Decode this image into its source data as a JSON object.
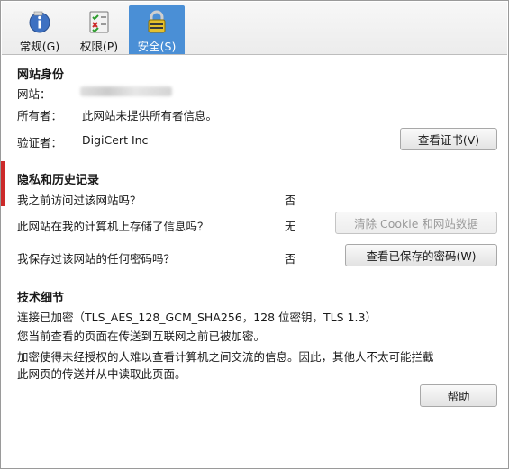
{
  "tabs": [
    {
      "label": "常规(G)",
      "icon": "info-icon"
    },
    {
      "label": "权限(P)",
      "icon": "permissions-icon"
    },
    {
      "label": "安全(S)",
      "icon": "lock-icon",
      "active": true
    }
  ],
  "identity": {
    "title": "网站身份",
    "website_label": "网站：",
    "owner_label": "所有者：",
    "owner_value": "此网站未提供所有者信息。",
    "verifier_label": "验证者：",
    "verifier_value": "DigiCert Inc",
    "view_cert_button": "查看证书(V)"
  },
  "privacy": {
    "title": "隐私和历史记录",
    "q1": "我之前访问过该网站吗？",
    "a1": "否",
    "q2": "此网站在我的计算机上存储了信息吗？",
    "a2": "无",
    "clear_button": "清除 Cookie 和网站数据",
    "q3": "我保存过该网站的任何密码吗？",
    "a3": "否",
    "saved_pw_button": "查看已保存的密码(W)"
  },
  "tech": {
    "title": "技术细节",
    "line1": "连接已加密（TLS_AES_128_GCM_SHA256，128 位密钥，TLS 1.3）",
    "line2": "您当前查看的页面在传送到互联网之前已被加密。",
    "line3": "加密使得未经授权的人难以查看计算机之间交流的信息。因此，其他人不太可能拦截",
    "line4": "此网页的传送并从中读取此页面。"
  },
  "help_button": "帮助",
  "colors": {
    "active_tab": "#4a8fd6",
    "window_border": "#9a9a9a"
  }
}
